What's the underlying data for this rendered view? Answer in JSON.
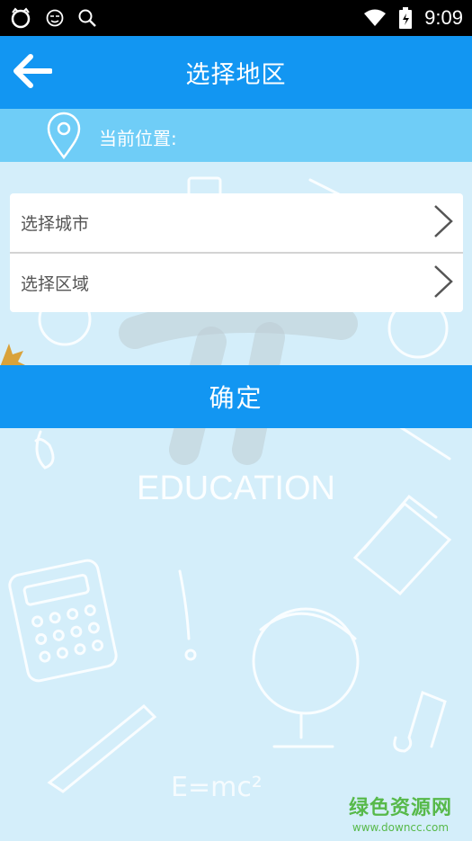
{
  "status_bar": {
    "time": "9:09",
    "icons_left": [
      "cat-icon",
      "emoji-icon",
      "search-icon"
    ],
    "icons_right": [
      "wifi-icon",
      "battery-icon"
    ]
  },
  "header": {
    "title": "选择地区",
    "back_icon": "back-arrow-icon"
  },
  "location": {
    "label": "当前位置:",
    "icon": "location-pin-icon"
  },
  "selection": {
    "rows": [
      {
        "label": "选择城市"
      },
      {
        "label": "选择区域"
      }
    ]
  },
  "confirm_label": "确定",
  "background": {
    "logo_text": "EDUCATION",
    "formula": "E=mc²"
  },
  "watermark": {
    "main": "绿色资源网",
    "sub": "www.downcc.com"
  },
  "colors": {
    "primary": "#1296f2",
    "location_bar": "#6fcdf7",
    "background": "#d4eefa",
    "watermark": "#57b94a"
  }
}
